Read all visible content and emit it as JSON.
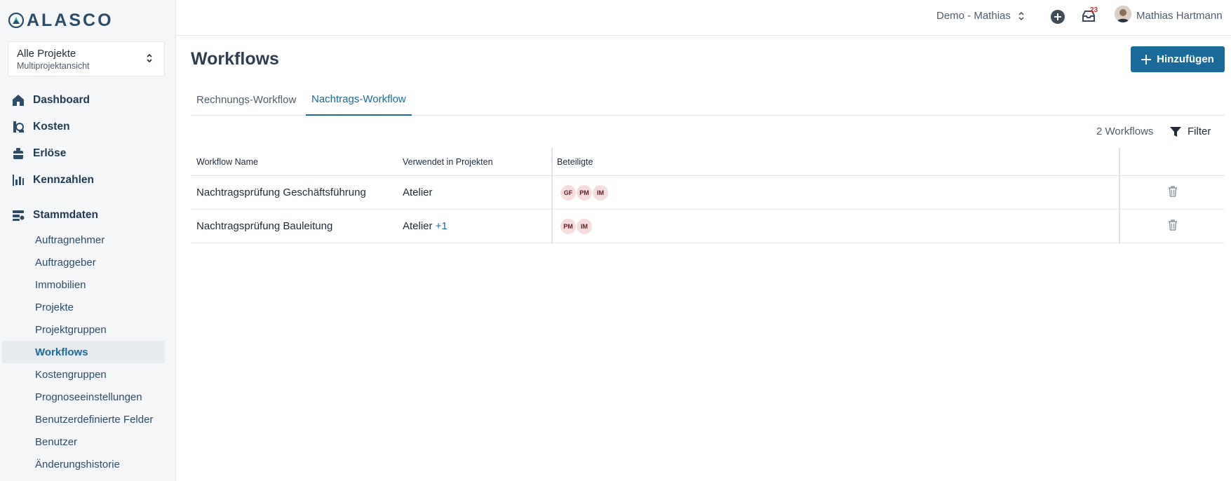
{
  "app": {
    "logo_text": "ALASCO"
  },
  "project_selector": {
    "title": "Alle Projekte",
    "subtitle": "Multiprojektansicht"
  },
  "sidebar": {
    "main_items": [
      {
        "label": "Dashboard",
        "icon": "home-icon"
      },
      {
        "label": "Kosten",
        "icon": "costs-icon"
      },
      {
        "label": "Erlöse",
        "icon": "revenue-icon"
      },
      {
        "label": "Kennzahlen",
        "icon": "chart-icon"
      }
    ],
    "section": {
      "label": "Stammdaten",
      "icon": "masterdata-icon"
    },
    "sub_items": [
      {
        "label": "Auftragnehmer"
      },
      {
        "label": "Auftraggeber"
      },
      {
        "label": "Immobilien"
      },
      {
        "label": "Projekte"
      },
      {
        "label": "Projektgruppen"
      },
      {
        "label": "Workflows",
        "active": true
      },
      {
        "label": "Kostengruppen"
      },
      {
        "label": "Prognoseeinstellungen"
      },
      {
        "label": "Benutzerdefinierte Felder"
      },
      {
        "label": "Benutzer"
      },
      {
        "label": "Änderungshistorie"
      }
    ]
  },
  "topbar": {
    "tenant": "Demo - Mathias",
    "notification_count": "23",
    "user_name": "Mathias Hartmann"
  },
  "page": {
    "title": "Workflows",
    "add_button": "Hinzufügen",
    "tabs": [
      {
        "label": "Rechnungs-Workflow",
        "active": false
      },
      {
        "label": "Nachtrags-Workflow",
        "active": true
      }
    ],
    "count_label": "2 Workflows",
    "filter_label": "Filter"
  },
  "table": {
    "columns": [
      "Workflow Name",
      "Verwendet in Projekten",
      "Beteiligte"
    ],
    "rows": [
      {
        "name": "Nachtragsprüfung Geschäftsführung",
        "project": "Atelier",
        "more": "",
        "participants": [
          "GF",
          "PM",
          "IM"
        ]
      },
      {
        "name": "Nachtragsprüfung Bauleitung",
        "project": "Atelier",
        "more": "+1",
        "participants": [
          "PM",
          "IM"
        ]
      }
    ]
  },
  "colors": {
    "primary": "#1a6b99",
    "sidebar_bg": "#f5f6f8",
    "chip_bg": "#f6dcdc",
    "badge": "#d32f2f"
  }
}
